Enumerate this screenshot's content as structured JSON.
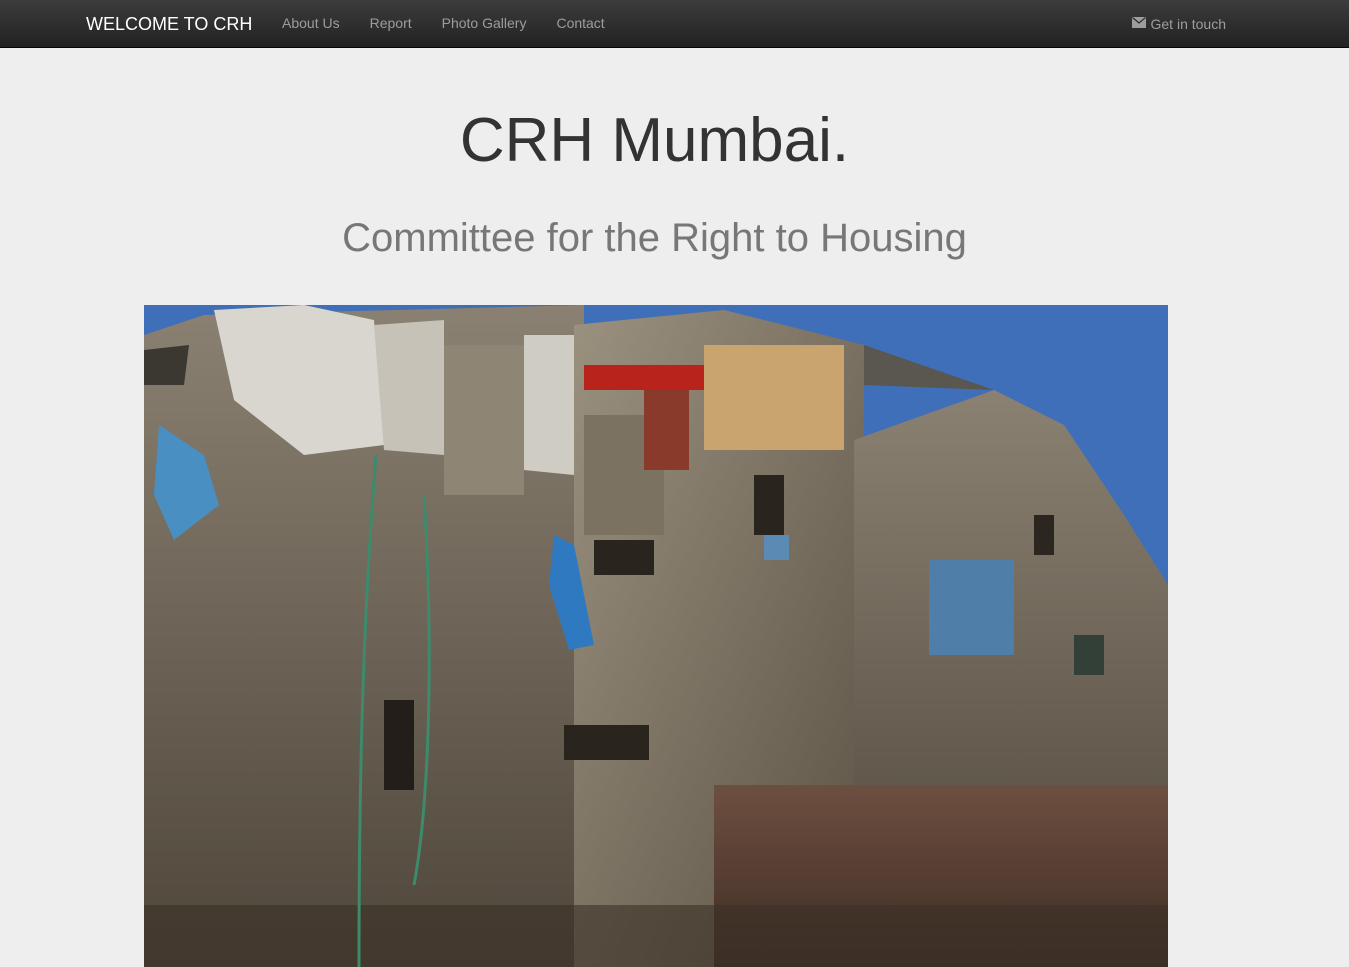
{
  "navbar": {
    "brand": "WELCOME TO CRH",
    "links": [
      {
        "label": "About Us"
      },
      {
        "label": "Report"
      },
      {
        "label": "Photo Gallery"
      },
      {
        "label": "Contact"
      }
    ],
    "contact_label": "Get in touch",
    "contact_icon": "envelope-icon"
  },
  "hero": {
    "title": "CRH Mumbai.",
    "subtitle": "Committee for the Right to Housing"
  },
  "colors": {
    "navbar_bg": "#222222",
    "page_bg": "#eeeeee",
    "nav_text": "#9d9d9d",
    "title_text": "#333333",
    "subtitle_text": "#777777",
    "sky": "#3f6fb8"
  }
}
